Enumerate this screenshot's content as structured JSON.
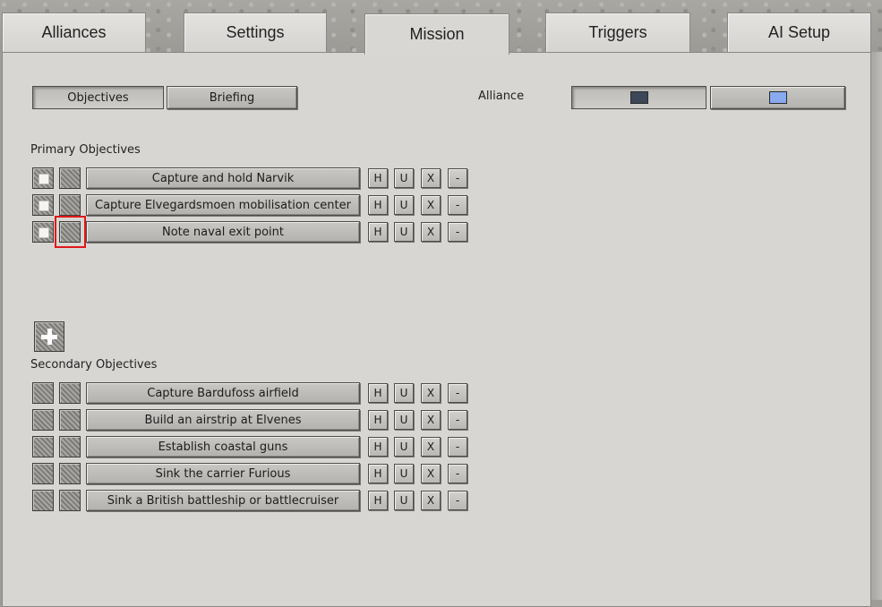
{
  "tabs": [
    {
      "label": "Alliances"
    },
    {
      "label": "Settings"
    },
    {
      "label": "Mission"
    },
    {
      "label": "Triggers"
    },
    {
      "label": "AI Setup"
    }
  ],
  "active_tab": "Mission",
  "subtabs": {
    "objectives": "Objectives",
    "briefing": "Briefing"
  },
  "alliance": {
    "label": "Alliance",
    "colors": [
      "#3c4858",
      "#88aaee"
    ]
  },
  "primary": {
    "label": "Primary Objectives",
    "items": [
      {
        "name": "Capture and hold Narvik"
      },
      {
        "name": "Capture Elvegardsmoen mobilisation center"
      },
      {
        "name": "Note naval exit point"
      }
    ]
  },
  "secondary": {
    "label": "Secondary Objectives",
    "items": [
      {
        "name": "Capture Bardufoss airfield"
      },
      {
        "name": "Build an airstrip at Elvenes"
      },
      {
        "name": "Establish coastal guns"
      },
      {
        "name": "Sink the carrier Furious"
      },
      {
        "name": "Sink a British battleship or battlecruiser"
      }
    ]
  },
  "row_buttons": {
    "h": "H",
    "u": "U",
    "x": "X",
    "minus": "-"
  },
  "icons": {
    "add": "plus-icon",
    "checkbox": "checkbox-icon"
  }
}
